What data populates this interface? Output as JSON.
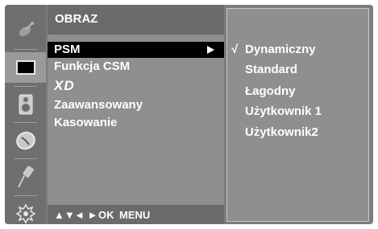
{
  "menu": {
    "title": "OBRAZ",
    "items": [
      {
        "label": "PSM",
        "selected": true
      },
      {
        "label": "Funkcja CSM"
      },
      {
        "label": "XD",
        "logo": true
      },
      {
        "label": "Zaawansowany"
      },
      {
        "label": "Kasowanie"
      }
    ]
  },
  "sidebar": {
    "icons": [
      "satellite-icon",
      "screen-icon",
      "speaker-icon",
      "clock-icon",
      "plug-icon",
      "settings-icon"
    ],
    "active": "screen-icon"
  },
  "submenu": {
    "check_mark": "√",
    "items": [
      {
        "label": "Dynamiczny",
        "checked": true
      },
      {
        "label": "Standard"
      },
      {
        "label": "Łagodny"
      },
      {
        "label": "Użytkownik 1"
      },
      {
        "label": "Użytkownik2"
      }
    ]
  },
  "footer": {
    "arrows_ud": "▲▼",
    "arrows_lr": "◄ ►",
    "ok": "OK",
    "menu": "MENU"
  },
  "colors": {
    "panel": "#8f8f8f",
    "title_bar": "#6b6b6b",
    "selected": "#000000"
  }
}
